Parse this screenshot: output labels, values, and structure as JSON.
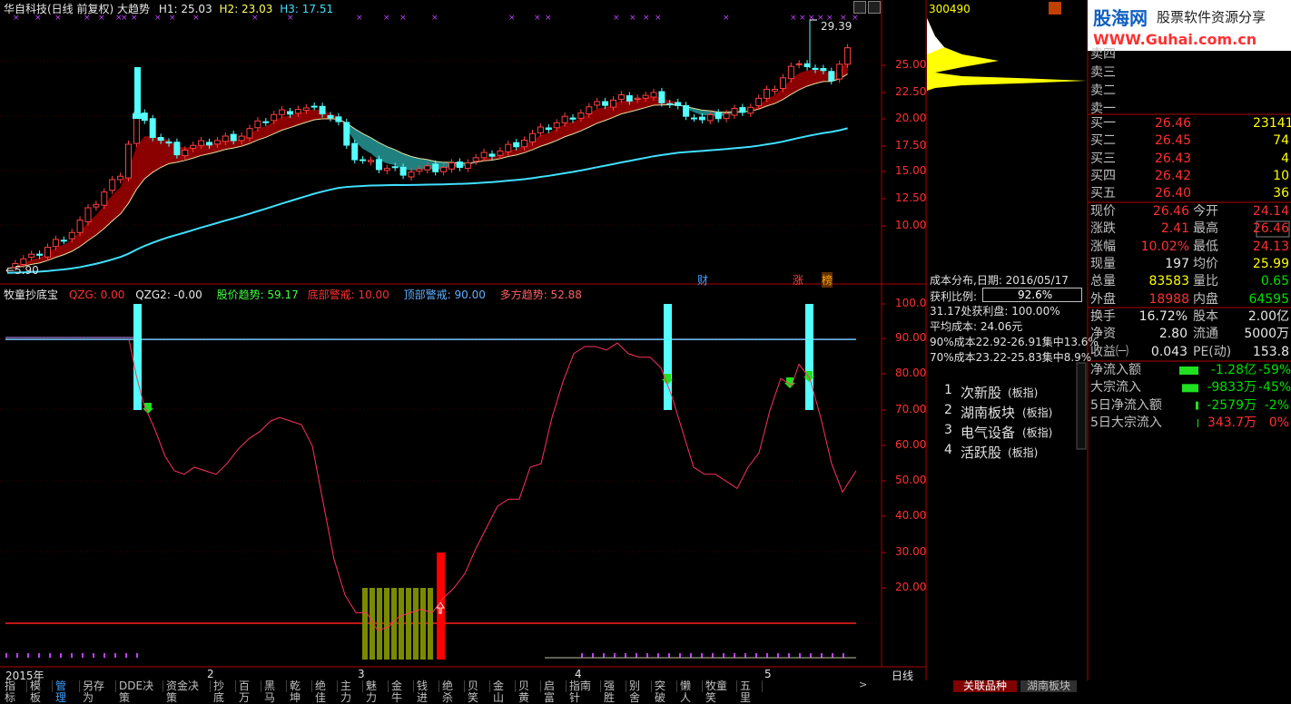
{
  "main_chart": {
    "title": "华自科技(日线 前复权) 大趋势",
    "h1": "H1: 25.03",
    "h2": "H2: 23.03",
    "h3": "H3: 17.51",
    "high_label": "29.39",
    "low_label": "5.90",
    "price_ticks": [
      "25.00",
      "22.50",
      "20.00",
      "17.50",
      "15.00",
      "12.50",
      "10.00"
    ],
    "markers": [
      "财",
      "涨",
      "榜"
    ]
  },
  "indicator": {
    "name": "牧童抄底宝",
    "qzg": "QZG: 0.00",
    "qzg2": "QZG2: -0.00",
    "trend": "股价趋势: 59.17",
    "bottom": "底部警戒: 10.00",
    "top": "顶部警戒: 90.00",
    "long": "多方趋势: 52.88",
    "ticks": [
      "100.0",
      "90.00",
      "80.00",
      "70.00",
      "60.00",
      "50.00",
      "40.00",
      "30.00",
      "20.00"
    ]
  },
  "timeline": {
    "labels": [
      "2015年",
      "2",
      "3",
      "4",
      "5"
    ],
    "period": "日线"
  },
  "bottom_tabs": [
    "指标",
    "模板",
    "管理",
    "另存为",
    "DDE决策",
    "资金决策",
    "抄底",
    "百万",
    "黑马",
    "乾坤",
    "绝佳",
    "主力",
    "魅力",
    "金牛",
    "钱进",
    "绝杀",
    "贝笑",
    "金山",
    "贝黄",
    "启富",
    "指南针",
    "强胜",
    "别舍",
    "突破",
    "懒人",
    "牧童笑",
    "五里"
  ],
  "bottom_right_tabs": [
    "关联品种",
    "湖南板块"
  ],
  "right_panel": {
    "code": "300490",
    "brand": "股海网",
    "brand_slogan": "股票软件资源分享",
    "brand_url": "WWW.Guhai.com.cn",
    "asks": [
      {
        "label": "卖四"
      },
      {
        "label": "卖三"
      },
      {
        "label": "卖二"
      },
      {
        "label": "卖一"
      }
    ],
    "bids": [
      {
        "label": "买一",
        "price": "26.46",
        "vol": "23141"
      },
      {
        "label": "买二",
        "price": "26.45",
        "vol": "74"
      },
      {
        "label": "买三",
        "price": "26.43",
        "vol": "4"
      },
      {
        "label": "买四",
        "price": "26.42",
        "vol": "10"
      },
      {
        "label": "买五",
        "price": "26.40",
        "vol": "36"
      }
    ],
    "quote": [
      {
        "l1": "现价",
        "v1": "26.46",
        "l2": "今开",
        "v2": "24.14"
      },
      {
        "l1": "涨跌",
        "v1": "2.41",
        "l2": "最高",
        "v2": "26.46"
      },
      {
        "l1": "涨幅",
        "v1": "10.02%",
        "l2": "最低",
        "v2": "24.13"
      },
      {
        "l1": "现量",
        "v1": "197",
        "l2": "均价",
        "v2": "25.99"
      },
      {
        "l1": "总量",
        "v1": "83583",
        "l2": "量比",
        "v2": "0.65"
      },
      {
        "l1": "外盘",
        "v1": "18988",
        "l2": "内盘",
        "v2": "64595"
      }
    ],
    "info": [
      {
        "l1": "换手",
        "v1": "16.72%",
        "l2": "股本",
        "v2": "2.00亿"
      },
      {
        "l1": "净资",
        "v1": "2.80",
        "l2": "流通",
        "v2": "5000万"
      },
      {
        "l1": "收益㈠",
        "v1": "0.043",
        "l2": "PE(动)",
        "v2": "153.8"
      }
    ],
    "flows": [
      {
        "label": "净流入额",
        "value": "-1.28亿",
        "pct": "-59%",
        "bar": 0.8
      },
      {
        "label": "大宗流入",
        "value": "-9833万",
        "pct": "-45%",
        "bar": 0.7
      },
      {
        "label": "5日净流入额",
        "value": "-2579万",
        "pct": "-2%",
        "bar": 0.1
      },
      {
        "label": "5日大宗流入",
        "value": "343.7万",
        "pct": "0%",
        "bar": 0.05
      }
    ]
  },
  "cost_panel": {
    "title": "成本分布,日期: 2016/05/17",
    "profit_label": "获利比例:",
    "profit_value": "92.6%",
    "line1": "31.17处获利盘: 100.00%",
    "line2": "平均成本: 24.06元",
    "line3": "90%成本22.92-26.91集中13.6%",
    "line4": "70%成本23.22-25.83集中8.9%"
  },
  "sectors": [
    {
      "num": "1",
      "name": "次新股",
      "tag": "(板指)"
    },
    {
      "num": "2",
      "name": "湖南板块",
      "tag": "(板指)"
    },
    {
      "num": "3",
      "name": "电气设备",
      "tag": "(板指)"
    },
    {
      "num": "4",
      "name": "活跃股",
      "tag": "(板指)"
    }
  ],
  "colors": {
    "up": "#ff3030",
    "down": "#54ffff",
    "band_up": "#8b0000",
    "band_down": "#208080",
    "ma": "#40e0ff",
    "top_line": "#70c8ff",
    "bottom_line": "#ff2020",
    "osc": "#ff3060"
  }
}
